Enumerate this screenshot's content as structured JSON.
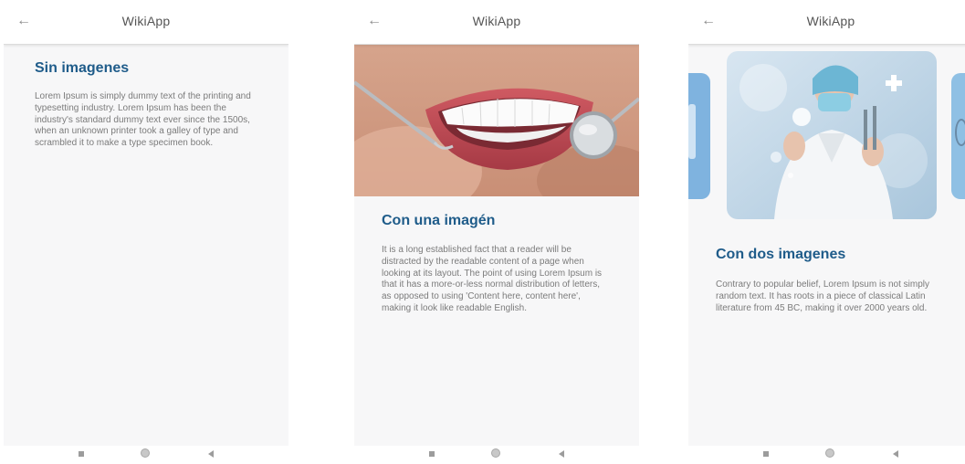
{
  "app": {
    "title": "WikiApp",
    "back_icon": "arrow-left-icon",
    "accent_color": "#b01e3a",
    "heading_color": "#1f5c8a"
  },
  "screens": [
    {
      "heading": "Sin imagenes",
      "body": "Lorem Ipsum is simply dummy text of the printing and typesetting industry. Lorem Ipsum has been the industry's standard dummy text ever since the 1500s, when an unknown printer took a galley of type and scrambled it to make a type specimen book."
    },
    {
      "heading": "Con una imagén",
      "body": "It is a long established fact that a reader will be distracted by the readable content of a page when looking at its layout. The point of using Lorem Ipsum is that it has a more-or-less normal distribution of letters, as opposed to using 'Content here, content here', making it look like readable English."
    },
    {
      "heading": "Con dos imagenes",
      "body": "Contrary to popular belief, Lorem Ipsum is not simply random text. It has roots in a piece of classical Latin literature from 45 BC, making it over 2000 years old."
    }
  ],
  "navigation_bar": {
    "icons": [
      "recents-square-icon",
      "home-circle-icon",
      "back-triangle-icon"
    ]
  }
}
